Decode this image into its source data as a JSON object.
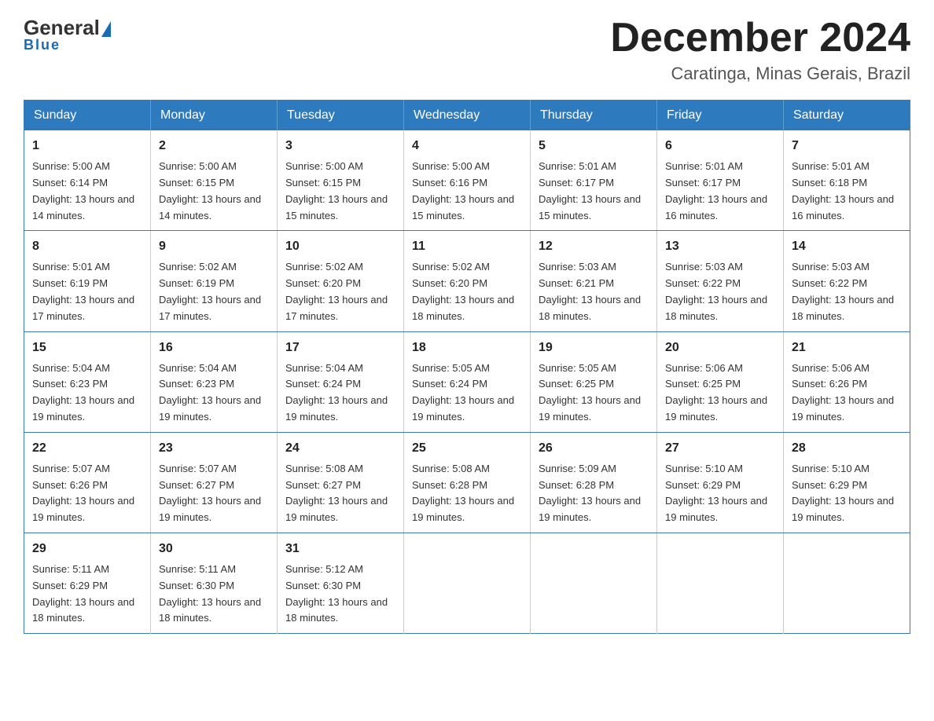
{
  "logo": {
    "general": "General",
    "blue": "Blue",
    "tagline": "Blue"
  },
  "header": {
    "title": "December 2024",
    "location": "Caratinga, Minas Gerais, Brazil"
  },
  "weekdays": [
    "Sunday",
    "Monday",
    "Tuesday",
    "Wednesday",
    "Thursday",
    "Friday",
    "Saturday"
  ],
  "weeks": [
    [
      {
        "day": "1",
        "sunrise": "5:00 AM",
        "sunset": "6:14 PM",
        "daylight": "13 hours and 14 minutes."
      },
      {
        "day": "2",
        "sunrise": "5:00 AM",
        "sunset": "6:15 PM",
        "daylight": "13 hours and 14 minutes."
      },
      {
        "day": "3",
        "sunrise": "5:00 AM",
        "sunset": "6:15 PM",
        "daylight": "13 hours and 15 minutes."
      },
      {
        "day": "4",
        "sunrise": "5:00 AM",
        "sunset": "6:16 PM",
        "daylight": "13 hours and 15 minutes."
      },
      {
        "day": "5",
        "sunrise": "5:01 AM",
        "sunset": "6:17 PM",
        "daylight": "13 hours and 15 minutes."
      },
      {
        "day": "6",
        "sunrise": "5:01 AM",
        "sunset": "6:17 PM",
        "daylight": "13 hours and 16 minutes."
      },
      {
        "day": "7",
        "sunrise": "5:01 AM",
        "sunset": "6:18 PM",
        "daylight": "13 hours and 16 minutes."
      }
    ],
    [
      {
        "day": "8",
        "sunrise": "5:01 AM",
        "sunset": "6:19 PM",
        "daylight": "13 hours and 17 minutes."
      },
      {
        "day": "9",
        "sunrise": "5:02 AM",
        "sunset": "6:19 PM",
        "daylight": "13 hours and 17 minutes."
      },
      {
        "day": "10",
        "sunrise": "5:02 AM",
        "sunset": "6:20 PM",
        "daylight": "13 hours and 17 minutes."
      },
      {
        "day": "11",
        "sunrise": "5:02 AM",
        "sunset": "6:20 PM",
        "daylight": "13 hours and 18 minutes."
      },
      {
        "day": "12",
        "sunrise": "5:03 AM",
        "sunset": "6:21 PM",
        "daylight": "13 hours and 18 minutes."
      },
      {
        "day": "13",
        "sunrise": "5:03 AM",
        "sunset": "6:22 PM",
        "daylight": "13 hours and 18 minutes."
      },
      {
        "day": "14",
        "sunrise": "5:03 AM",
        "sunset": "6:22 PM",
        "daylight": "13 hours and 18 minutes."
      }
    ],
    [
      {
        "day": "15",
        "sunrise": "5:04 AM",
        "sunset": "6:23 PM",
        "daylight": "13 hours and 19 minutes."
      },
      {
        "day": "16",
        "sunrise": "5:04 AM",
        "sunset": "6:23 PM",
        "daylight": "13 hours and 19 minutes."
      },
      {
        "day": "17",
        "sunrise": "5:04 AM",
        "sunset": "6:24 PM",
        "daylight": "13 hours and 19 minutes."
      },
      {
        "day": "18",
        "sunrise": "5:05 AM",
        "sunset": "6:24 PM",
        "daylight": "13 hours and 19 minutes."
      },
      {
        "day": "19",
        "sunrise": "5:05 AM",
        "sunset": "6:25 PM",
        "daylight": "13 hours and 19 minutes."
      },
      {
        "day": "20",
        "sunrise": "5:06 AM",
        "sunset": "6:25 PM",
        "daylight": "13 hours and 19 minutes."
      },
      {
        "day": "21",
        "sunrise": "5:06 AM",
        "sunset": "6:26 PM",
        "daylight": "13 hours and 19 minutes."
      }
    ],
    [
      {
        "day": "22",
        "sunrise": "5:07 AM",
        "sunset": "6:26 PM",
        "daylight": "13 hours and 19 minutes."
      },
      {
        "day": "23",
        "sunrise": "5:07 AM",
        "sunset": "6:27 PM",
        "daylight": "13 hours and 19 minutes."
      },
      {
        "day": "24",
        "sunrise": "5:08 AM",
        "sunset": "6:27 PM",
        "daylight": "13 hours and 19 minutes."
      },
      {
        "day": "25",
        "sunrise": "5:08 AM",
        "sunset": "6:28 PM",
        "daylight": "13 hours and 19 minutes."
      },
      {
        "day": "26",
        "sunrise": "5:09 AM",
        "sunset": "6:28 PM",
        "daylight": "13 hours and 19 minutes."
      },
      {
        "day": "27",
        "sunrise": "5:10 AM",
        "sunset": "6:29 PM",
        "daylight": "13 hours and 19 minutes."
      },
      {
        "day": "28",
        "sunrise": "5:10 AM",
        "sunset": "6:29 PM",
        "daylight": "13 hours and 19 minutes."
      }
    ],
    [
      {
        "day": "29",
        "sunrise": "5:11 AM",
        "sunset": "6:29 PM",
        "daylight": "13 hours and 18 minutes."
      },
      {
        "day": "30",
        "sunrise": "5:11 AM",
        "sunset": "6:30 PM",
        "daylight": "13 hours and 18 minutes."
      },
      {
        "day": "31",
        "sunrise": "5:12 AM",
        "sunset": "6:30 PM",
        "daylight": "13 hours and 18 minutes."
      },
      null,
      null,
      null,
      null
    ]
  ]
}
